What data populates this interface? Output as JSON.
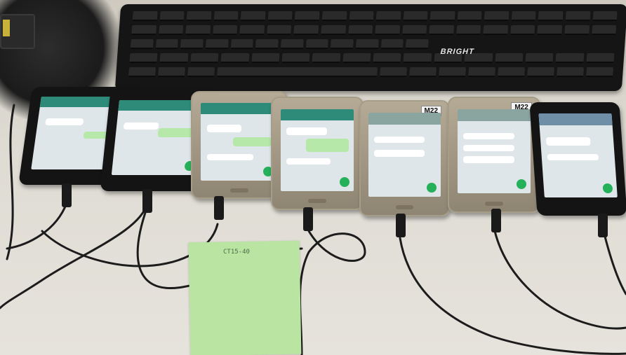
{
  "scene": {
    "keyboard_brand": "BRIGHT",
    "phone_labels": [
      "M22",
      "M22"
    ],
    "note_text": "CT15-40",
    "phones": [
      {
        "body": "black",
        "screen": "chat",
        "labelled": false
      },
      {
        "body": "black",
        "screen": "chat",
        "labelled": false
      },
      {
        "body": "gold",
        "screen": "chat",
        "labelled": false
      },
      {
        "body": "gold",
        "screen": "chat",
        "labelled": false
      },
      {
        "body": "gold",
        "screen": "chat",
        "labelled": true
      },
      {
        "body": "gold",
        "screen": "chat",
        "labelled": true
      },
      {
        "body": "black",
        "screen": "chat",
        "labelled": false
      }
    ],
    "colors": {
      "desk": "#dedbd3",
      "keyboard": "#151515",
      "note": "#b9e4a2",
      "app_bar": "#2e8b7a",
      "chat_bubble": "#b6e8a9"
    }
  }
}
